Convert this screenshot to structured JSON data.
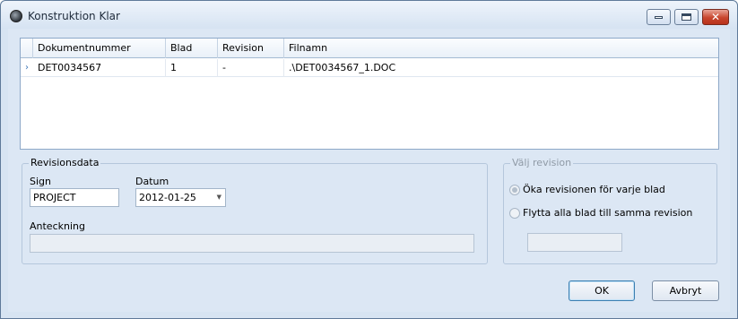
{
  "window": {
    "title": "Konstruktion Klar"
  },
  "grid": {
    "columns": [
      "Dokumentnummer",
      "Blad",
      "Revision",
      "Filnamn"
    ],
    "rows": [
      {
        "Dokumentnummer": "DET0034567",
        "Blad": "1",
        "Revision": "-",
        "Filnamn": ".\\DET0034567_1.DOC"
      }
    ],
    "row_indicator": "›"
  },
  "revisionsdata": {
    "legend": "Revisionsdata",
    "sign_label": "Sign",
    "sign_value": "PROJECT",
    "datum_label": "Datum",
    "datum_value": "2012-01-25",
    "anteckning_label": "Anteckning",
    "anteckning_value": ""
  },
  "valj_revision": {
    "legend": "Välj revision",
    "option1": "Öka revisionen för varje blad",
    "option2": "Flytta alla blad till samma revision",
    "revision_value": ""
  },
  "buttons": {
    "ok": "OK",
    "cancel": "Avbryt"
  }
}
